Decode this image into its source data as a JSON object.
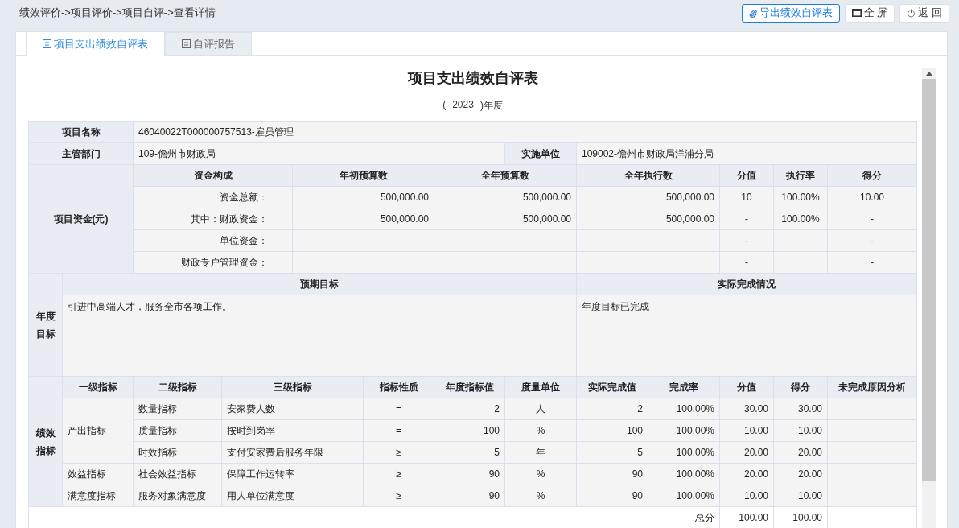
{
  "breadcrumb": "绩效评价->项目评价->项目自评->查看详情",
  "toolbar": [
    {
      "kind": "export",
      "label": "导出绩效自评表"
    },
    {
      "kind": "fullscreen",
      "label": "全 屏"
    },
    {
      "kind": "back",
      "label": "返 回"
    }
  ],
  "tabs": [
    {
      "label": "项目支出绩效自评表",
      "selected": true
    },
    {
      "label": "自评报告",
      "selected": false
    }
  ],
  "form": {
    "title": "项目支出绩效自评表",
    "year_open": "(",
    "year": "2023",
    "year_close": ")年度",
    "project_name": {
      "label": "项目名称",
      "value": "46040022T000000757513-雇员管理"
    },
    "department": {
      "label": "主管部门",
      "value": "109-儋州市财政局"
    },
    "implementer": {
      "label": "实施单位",
      "value": "109002-儋州市财政局洋浦分局"
    },
    "funds": {
      "label": "项目资金(元)",
      "columns": [
        "资金构成",
        "年初预算数",
        "全年预算数",
        "全年执行数",
        "分值",
        "执行率",
        "得分"
      ],
      "rows": [
        [
          "资金总额：",
          "500,000.00",
          "500,000.00",
          "500,000.00",
          "10",
          "100.00%",
          "10.00"
        ],
        [
          "其中：财政资金：",
          "500,000.00",
          "500,000.00",
          "500,000.00",
          "-",
          "100.00%",
          "-"
        ],
        [
          "单位资金：",
          "",
          "",
          "",
          "-",
          "",
          "-"
        ],
        [
          "财政专户管理资金：",
          "",
          "",
          "",
          "-",
          "",
          "-"
        ]
      ]
    },
    "goals": {
      "label": "年度目标",
      "columns": [
        "预期目标",
        "实际完成情况"
      ],
      "expected": "引进中高端人才，服务全市各项工作。",
      "actual": "年度目标已完成"
    },
    "indicators": {
      "label": "绩效指标",
      "columns": [
        "一级指标",
        "二级指标",
        "三级指标",
        "指标性质",
        "年度指标值",
        "度量单位",
        "实际完成值",
        "完成率",
        "分值",
        "得分",
        "未完成原因分析"
      ],
      "groups": [
        {
          "name": "产出指标",
          "rows": [
            [
              "数量指标",
              "安家费人数",
              "=",
              "2",
              "人",
              "2",
              "100.00%",
              "30.00",
              "30.00"
            ],
            [
              "质量指标",
              "按时到岗率",
              "=",
              "100",
              "%",
              "100",
              "100.00%",
              "10.00",
              "10.00"
            ],
            [
              "时效指标",
              "支付安家费后服务年限",
              "≥",
              "5",
              "年",
              "5",
              "100.00%",
              "20.00",
              "20.00"
            ]
          ]
        },
        {
          "name": "效益指标",
          "rows": [
            [
              "社会效益指标",
              "保障工作运转率",
              "≥",
              "90",
              "%",
              "90",
              "100.00%",
              "20.00",
              "20.00"
            ]
          ]
        },
        {
          "name": "满意度指标",
          "rows": [
            [
              "服务对象满意度",
              "用人单位满意度",
              "≥",
              "90",
              "%",
              "90",
              "100.00%",
              "10.00",
              "10.00"
            ]
          ]
        }
      ],
      "total": {
        "label": "总分",
        "weight": "100.00",
        "score": "100.00"
      }
    }
  }
}
